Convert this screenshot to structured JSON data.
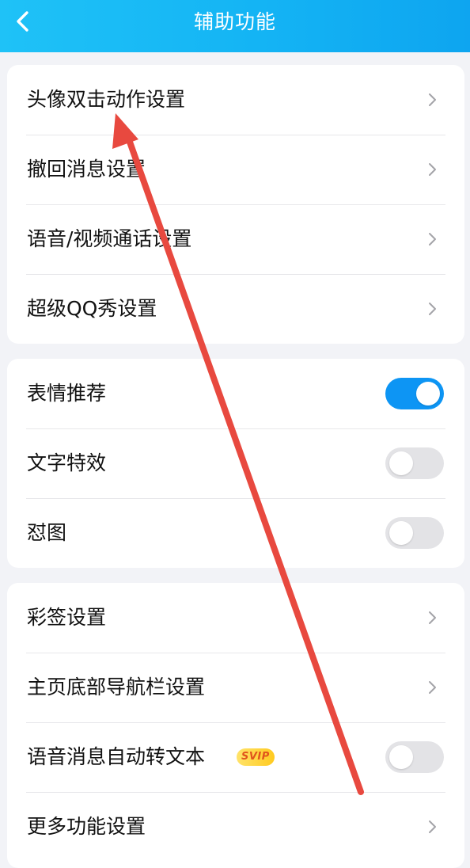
{
  "header": {
    "title": "辅助功能",
    "back_icon": "chevron-left-icon"
  },
  "colors": {
    "header_gradient_start": "#1fc2f7",
    "header_gradient_end": "#0ea5f0",
    "toggle_on": "#0d95f4",
    "toggle_off": "#e3e3e6",
    "annotation_arrow": "#e8493f",
    "background": "#f2f3f7"
  },
  "group1": {
    "items": [
      {
        "label": "头像双击动作设置",
        "icon": "chevron-right-icon"
      },
      {
        "label": "撤回消息设置",
        "icon": "chevron-right-icon"
      },
      {
        "label": "语音/视频通话设置",
        "icon": "chevron-right-icon"
      },
      {
        "label": "超级QQ秀设置",
        "icon": "chevron-right-icon"
      }
    ]
  },
  "group2": {
    "items": [
      {
        "label": "表情推荐",
        "toggle": true
      },
      {
        "label": "文字特效",
        "toggle": false
      },
      {
        "label": "怼图",
        "toggle": false
      }
    ]
  },
  "group3": {
    "items": [
      {
        "label": "彩签设置",
        "icon": "chevron-right-icon"
      },
      {
        "label": "主页底部导航栏设置",
        "icon": "chevron-right-icon"
      },
      {
        "label": "语音消息自动转文本",
        "badge": "SVIP",
        "toggle": false
      },
      {
        "label": "更多功能设置",
        "icon": "chevron-right-icon"
      }
    ]
  }
}
